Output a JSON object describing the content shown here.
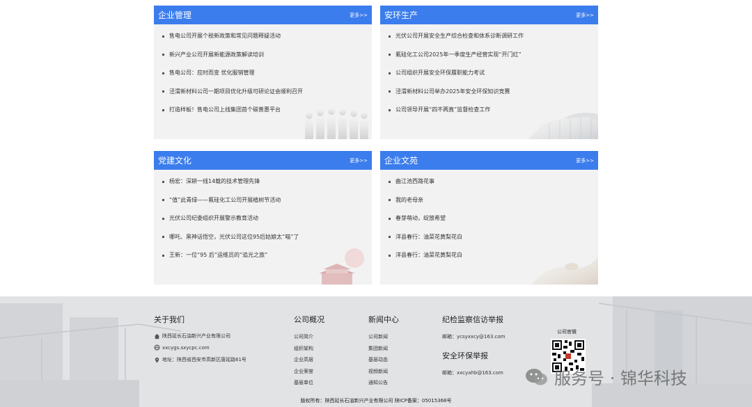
{
  "panels": [
    {
      "title": "企业管理",
      "more": "更多>>",
      "items": [
        "售电公司开展个税新政策和常见问题释疑活动",
        "新兴产业公司开展新能源政策解读培训",
        "售电公司：应时而变 优化服销管理",
        "泾渭新材料公司一期项目优化升级可研论证会顺利召开",
        "打造样板！售电公司上线集团首个碳普惠平台"
      ]
    },
    {
      "title": "安环生产",
      "more": "更多>>",
      "items": [
        "光伏公司开展安全生产综合检查和体系诊断调研工作",
        "氟硅化工公司2025年一季度生产经营实现“开门红”",
        "公司组织开展安全环保履职能力考试",
        "泾渭新材料公司举办2025年安全环保知识竞赛",
        "公司领导开展“四不两直”监督检查工作"
      ]
    },
    {
      "title": "党建文化",
      "more": "更多>>",
      "items": [
        "杨宏：深耕一线14载的技术管理先锋",
        "“值”此青绿——氟硅化工公司开展植树节活动",
        "光伏公司纪委组织开展警示教育活动",
        "哪吒、黑神话悟空，光伏公司这位95后姑娘太“喵”了",
        "王新：一位“95 后”运维员的“追光之旅”"
      ]
    },
    {
      "title": "企业文苑",
      "more": "更多>>",
      "items": [
        "曲江池西路花事",
        "我的老母亲",
        "春芽萌动，绽放希望",
        "洋县春行：油菜花黄梨花白",
        "洋县春行：油菜花黄梨花白"
      ]
    }
  ],
  "footer": {
    "about": {
      "title": "关于我们",
      "company": "陕西延长石油新兴产业有限公司",
      "website": "xxcygs.sxycpc.com",
      "address": "地址：陕西省西安市高新区唐延路61号"
    },
    "overview": {
      "title": "公司概况",
      "links": [
        "公司简介",
        "组织架构",
        "企业高层",
        "企业荣誉",
        "基层单位"
      ]
    },
    "news": {
      "title": "新闻中心",
      "links": [
        "公司新闻",
        "集团新闻",
        "基层动态",
        "视频新闻",
        "通知公告"
      ]
    },
    "discipline": {
      "title": "纪检监察信访举报",
      "email": "邮箱：ycsyxxcy@163.com"
    },
    "safety": {
      "title": "安全环保举报",
      "email": "邮箱：xxcyahb@163.com"
    },
    "qr_label": "公司官微",
    "copyright": "版权所有：陕西延长石油新兴产业有限公司 陕ICP备案：05015368号"
  },
  "watermark": "服务号 · 锦华科技",
  "colors": {
    "header_blue": "#3b7ded",
    "panel_bg": "#f2f2f2"
  }
}
